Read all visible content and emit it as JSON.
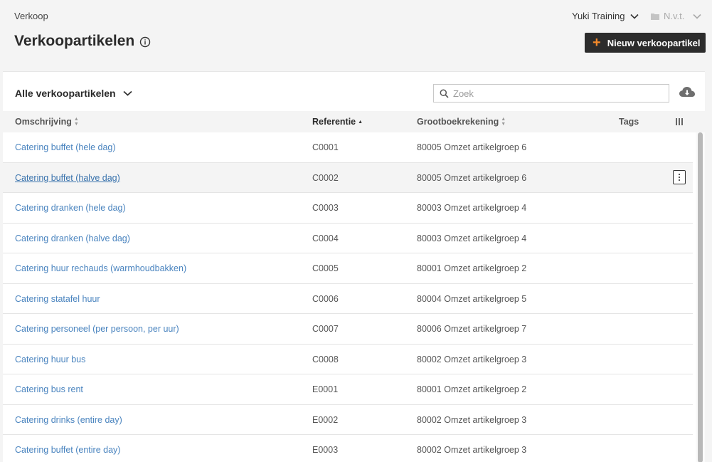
{
  "header": {
    "breadcrumb": "Verkoop",
    "title": "Verkoopartikelen",
    "company": "Yuki Training",
    "administration": "N.v.t.",
    "new_button_label": "Nieuw verkoopartikel"
  },
  "toolbar": {
    "filter_label": "Alle verkoopartikelen",
    "search_placeholder": "Zoek"
  },
  "columns": {
    "description": "Omschrijving",
    "reference": "Referentie",
    "ledger": "Grootboekrekening",
    "tags": "Tags"
  },
  "rows": [
    {
      "description": "Catering buffet (hele dag)",
      "reference": "C0001",
      "ledger": "80005 Omzet artikelgroep 6"
    },
    {
      "description": "Catering buffet (halve dag)",
      "reference": "C0002",
      "ledger": "80005 Omzet artikelgroep 6"
    },
    {
      "description": "Catering dranken (hele dag)",
      "reference": "C0003",
      "ledger": "80003 Omzet artikelgroep 4"
    },
    {
      "description": "Catering dranken (halve dag)",
      "reference": "C0004",
      "ledger": "80003 Omzet artikelgroep 4"
    },
    {
      "description": "Catering huur rechauds (warmhoudbakken)",
      "reference": "C0005",
      "ledger": "80001 Omzet artikelgroep 2"
    },
    {
      "description": "Catering statafel huur",
      "reference": "C0006",
      "ledger": "80004 Omzet artikelgroep 5"
    },
    {
      "description": "Catering personeel (per persoon, per uur)",
      "reference": "C0007",
      "ledger": "80006 Omzet artikelgroep 7"
    },
    {
      "description": "Catering huur bus",
      "reference": "C0008",
      "ledger": "80002 Omzet artikelgroep 3"
    },
    {
      "description": "Catering bus rent",
      "reference": "E0001",
      "ledger": "80001 Omzet artikelgroep 2"
    },
    {
      "description": "Catering drinks (entire day)",
      "reference": "E0002",
      "ledger": "80002 Omzet artikelgroep 3"
    },
    {
      "description": "Catering buffet (entire day)",
      "reference": "E0003",
      "ledger": "80002 Omzet artikelgroep 3"
    }
  ],
  "colors": {
    "accent": "#f58a2a",
    "link": "#4a84bf",
    "button_bg": "#2c2c2c"
  },
  "icons": {
    "info": "info-icon",
    "chevron": "chevron-down-icon",
    "folder": "folder-icon",
    "plus": "plus-icon",
    "search": "search-icon",
    "download": "cloud-download-icon",
    "columns": "columns-icon",
    "row_menu": "kebab-menu-icon"
  }
}
